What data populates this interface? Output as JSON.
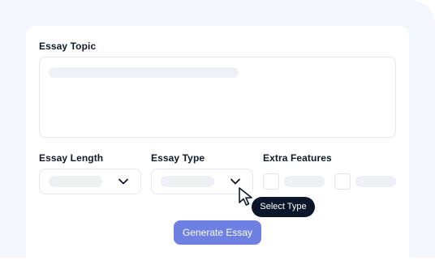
{
  "form": {
    "topic_label": "Essay Topic",
    "length_label": "Essay Length",
    "type_label": "Essay Type",
    "features_label": "Extra Features",
    "length_select": {
      "chevron_icon": "chevron-down-icon"
    },
    "type_select": {
      "chevron_icon": "chevron-down-icon"
    }
  },
  "tooltip": {
    "text": "Select Type"
  },
  "cursor": {
    "icon": "mouse-pointer-icon"
  },
  "actions": {
    "generate_label": "Generate Essay"
  },
  "colors": {
    "background": "#f3f7fd",
    "card": "#ffffff",
    "accent_button": "#6f80e3",
    "tooltip": "#0b1629",
    "placeholder": "#eef0f4",
    "border": "#e3e7ee",
    "label_text": "#111827"
  }
}
